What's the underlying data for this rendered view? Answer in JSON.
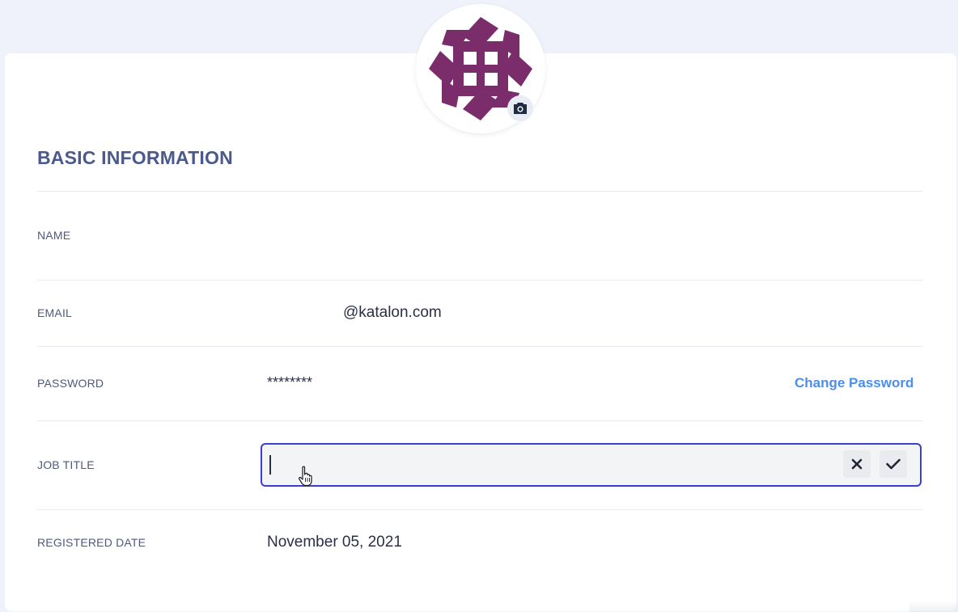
{
  "profile": {
    "avatar_alt": "Profile avatar",
    "brand_color": "#7b2d6b",
    "camera_icon": "camera-icon"
  },
  "section": {
    "title": "BASIC INFORMATION"
  },
  "fields": {
    "name": {
      "label": "NAME",
      "value": ""
    },
    "email": {
      "label": "EMAIL",
      "value": "@katalon.com"
    },
    "password": {
      "label": "PASSWORD",
      "value": "********",
      "action_label": "Change Password"
    },
    "job_title": {
      "label": "JOB TITLE",
      "value": "",
      "placeholder": "",
      "cancel_icon": "close-icon",
      "confirm_icon": "check-icon"
    },
    "registered_date": {
      "label": "REGISTERED DATE",
      "value": "November 05, 2021"
    }
  },
  "colors": {
    "accent": "#4a8ef0",
    "focus_border": "#3a3fcf",
    "title": "#4a5a8c"
  }
}
